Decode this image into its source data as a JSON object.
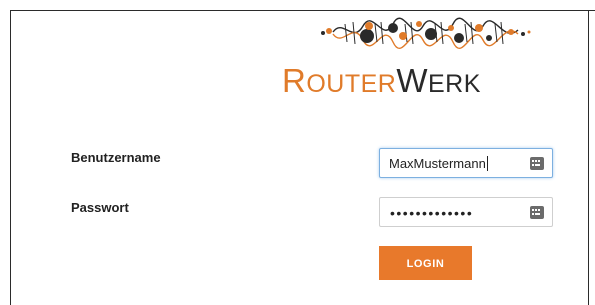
{
  "brand": {
    "name_part1_initial": "R",
    "name_part1_rest": "OUTER",
    "name_part2_initial": "W",
    "name_part2_rest": "ERK",
    "accent_color": "#e8792b"
  },
  "form": {
    "username_label": "Benutzername",
    "username_value": "MaxMustermann",
    "password_label": "Passwort",
    "password_mask": "•••••••••••••",
    "login_label": "LOGIN",
    "field_icon": "keyboard-icon"
  }
}
